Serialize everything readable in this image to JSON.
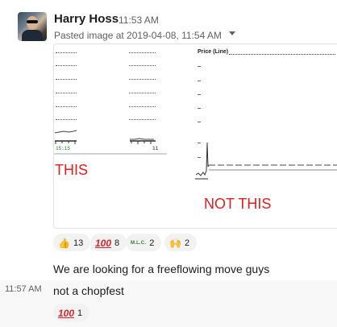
{
  "message": {
    "sender": "Harry Hoss",
    "timestamp": "11:53 AM",
    "attachment_caption": "Pasted image at 2019-04-08, 11:54 AM",
    "image": {
      "left_time_label": "15:15",
      "left_right_label": "11",
      "right_chart_title": "Price (Line)",
      "label_this": "THIS",
      "label_not_this": "NOT THIS"
    },
    "reactions": [
      {
        "icon": "thumbs-up-icon",
        "glyph": "👍",
        "count": "13"
      },
      {
        "icon": "hundred-icon",
        "glyph": "100",
        "count": "8"
      },
      {
        "icon": "mlc-icon",
        "glyph": "M.L.C.",
        "count": "2"
      },
      {
        "icon": "raised-hands-icon",
        "glyph": "🙌",
        "count": "2"
      }
    ],
    "text": "We are looking for a freeflowing move guys"
  },
  "followup": {
    "timestamp": "11:57 AM",
    "text": "not a chopfest",
    "reactions": [
      {
        "icon": "hundred-icon",
        "glyph": "100",
        "count": "1"
      }
    ]
  }
}
